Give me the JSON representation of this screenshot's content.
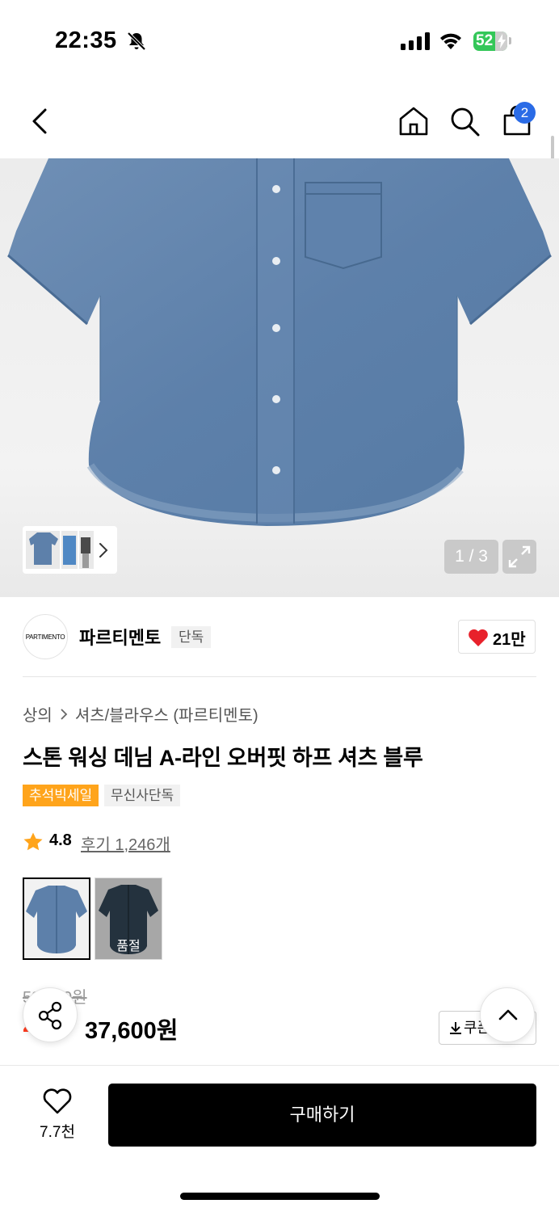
{
  "status_bar": {
    "time": "22:35",
    "battery": "52"
  },
  "nav": {
    "cart_count": "2"
  },
  "gallery": {
    "counter": "1 / 3"
  },
  "brand": {
    "logo_text": "PARTIMENTO",
    "name": "파르티멘토",
    "tag": "단독",
    "likes": "21만"
  },
  "breadcrumb": {
    "level1": "상의",
    "level2": "셔츠/블라우스 (파르티멘토)"
  },
  "product": {
    "title": "스톤 워싱 데님 A-라인 오버핏 하프 셔츠 블루",
    "badges": [
      "추석빅세일",
      "무신사단독"
    ],
    "rating": "4.8",
    "reviews": "후기 1,246개",
    "options": [
      {
        "color_name": "blue",
        "color": "#5b7fa8"
      },
      {
        "color_name": "navy",
        "status": "품절",
        "color": "#24323e"
      }
    ]
  },
  "price": {
    "original": "53,000원",
    "discount": "29%",
    "sale": "37,600원",
    "coupon_label": "쿠폰"
  },
  "bottom_bar": {
    "wish_count": "7.7천",
    "buy_label": "구매하기"
  },
  "colors": {
    "accent_blue": "#2a6be6",
    "sale_orange": "#ffa41b",
    "discount_red": "#ff3b1f",
    "heart_red": "#e8212b"
  }
}
